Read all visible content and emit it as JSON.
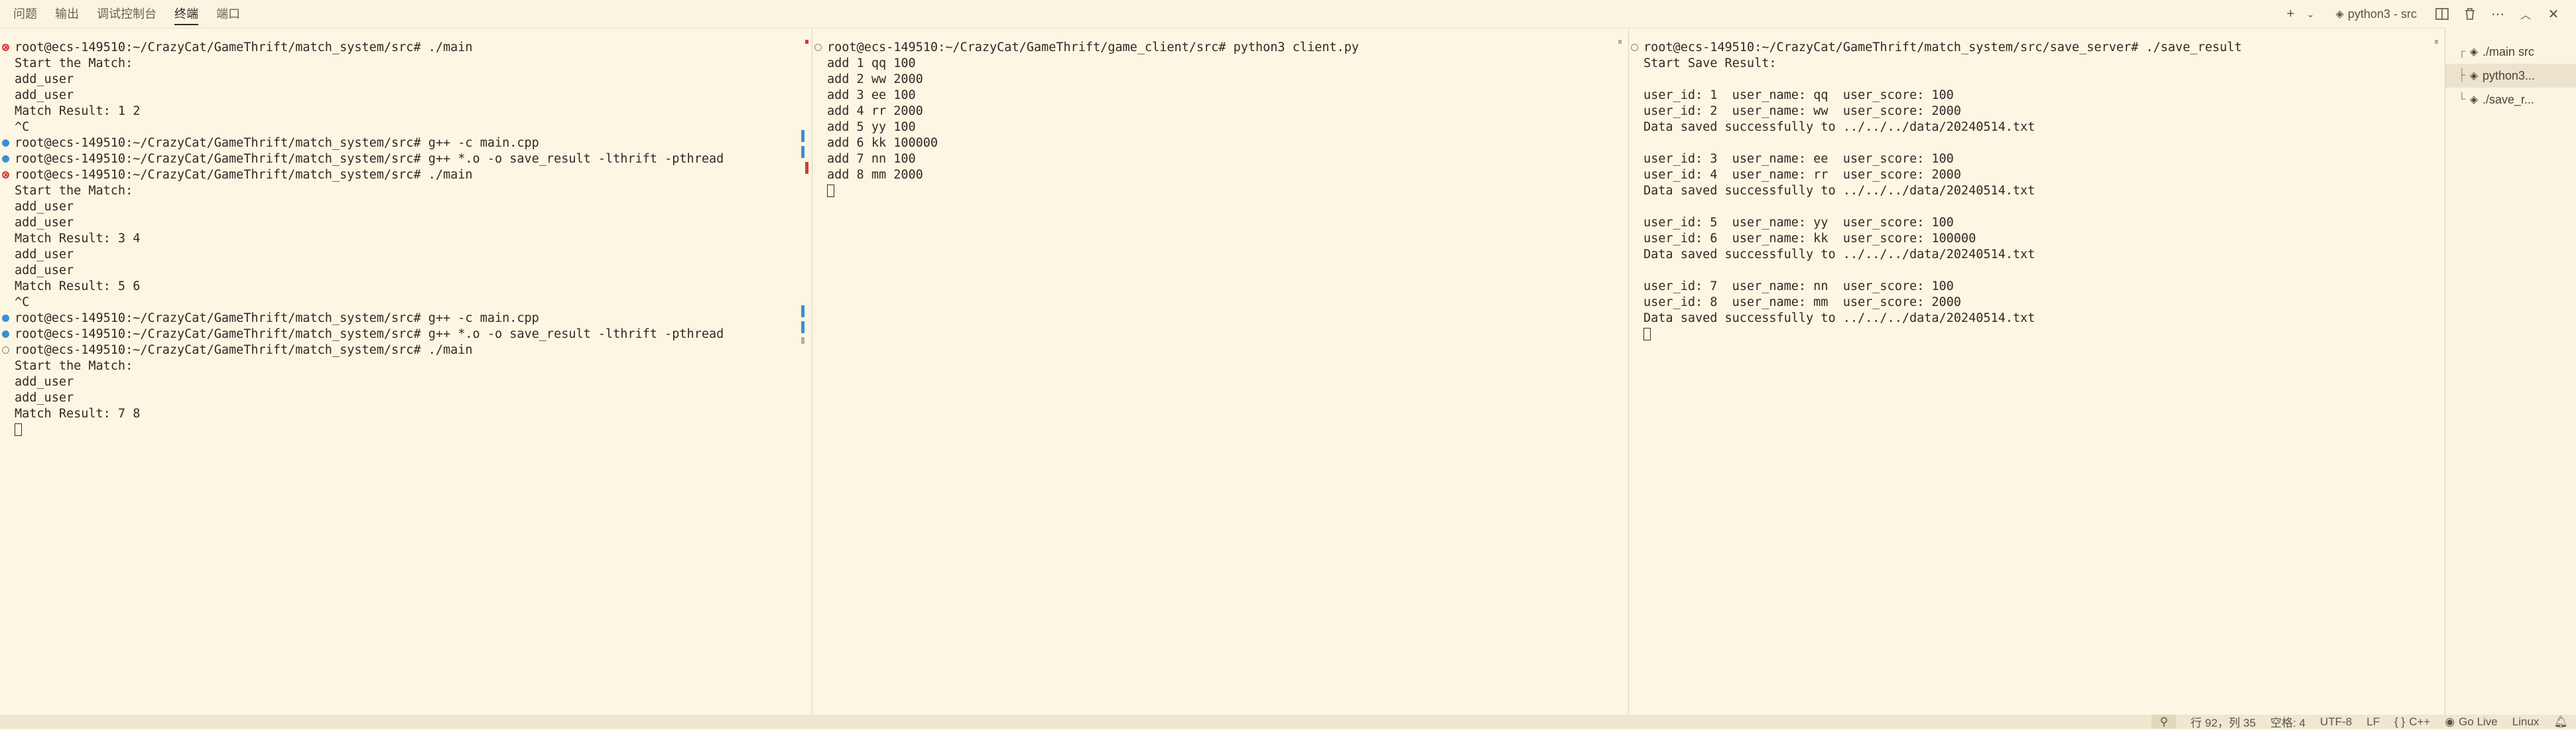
{
  "panel_tabs": [
    "问题",
    "输出",
    "调试控制台",
    "终端",
    "端口"
  ],
  "active_tab_index": 3,
  "toolbar": {
    "add_icon": "plus-icon",
    "terminal_label": "python3 - src"
  },
  "pane1": {
    "lines": [
      {
        "deco": "err",
        "text": "root@ecs-149510:~/CrazyCat/GameThrift/match_system/src# ./main"
      },
      {
        "deco": "",
        "text": "Start the Match:"
      },
      {
        "deco": "",
        "text": "add_user"
      },
      {
        "deco": "",
        "text": "add_user"
      },
      {
        "deco": "",
        "text": "Match Result: 1 2"
      },
      {
        "deco": "",
        "text": "^C"
      },
      {
        "deco": "ok",
        "text": "root@ecs-149510:~/CrazyCat/GameThrift/match_system/src# g++ -c main.cpp"
      },
      {
        "deco": "ok",
        "text": "root@ecs-149510:~/CrazyCat/GameThrift/match_system/src# g++ *.o -o save_result -lthrift -pthread"
      },
      {
        "deco": "err",
        "text": "root@ecs-149510:~/CrazyCat/GameThrift/match_system/src# ./main"
      },
      {
        "deco": "",
        "text": "Start the Match:"
      },
      {
        "deco": "",
        "text": "add_user"
      },
      {
        "deco": "",
        "text": "add_user"
      },
      {
        "deco": "",
        "text": "Match Result: 3 4"
      },
      {
        "deco": "",
        "text": "add_user"
      },
      {
        "deco": "",
        "text": "add_user"
      },
      {
        "deco": "",
        "text": "Match Result: 5 6"
      },
      {
        "deco": "",
        "text": "^C"
      },
      {
        "deco": "ok",
        "text": "root@ecs-149510:~/CrazyCat/GameThrift/match_system/src# g++ -c main.cpp"
      },
      {
        "deco": "ok",
        "text": "root@ecs-149510:~/CrazyCat/GameThrift/match_system/src# g++ *.o -o save_result -lthrift -pthread"
      },
      {
        "deco": "hollow",
        "text": "root@ecs-149510:~/CrazyCat/GameThrift/match_system/src# ./main"
      },
      {
        "deco": "",
        "text": "Start the Match:"
      },
      {
        "deco": "",
        "text": "add_user"
      },
      {
        "deco": "",
        "text": "add_user"
      },
      {
        "deco": "",
        "text": "Match Result: 7 8"
      }
    ]
  },
  "pane2": {
    "lines": [
      {
        "deco": "hollow",
        "text": "root@ecs-149510:~/CrazyCat/GameThrift/game_client/src# python3 client.py"
      },
      {
        "deco": "",
        "text": "add 1 qq 100"
      },
      {
        "deco": "",
        "text": "add 2 ww 2000"
      },
      {
        "deco": "",
        "text": "add 3 ee 100"
      },
      {
        "deco": "",
        "text": "add 4 rr 2000"
      },
      {
        "deco": "",
        "text": "add 5 yy 100"
      },
      {
        "deco": "",
        "text": "add 6 kk 100000"
      },
      {
        "deco": "",
        "text": "add 7 nn 100"
      },
      {
        "deco": "",
        "text": "add 8 mm 2000"
      }
    ]
  },
  "pane3": {
    "lines": [
      {
        "deco": "hollow",
        "text": "root@ecs-149510:~/CrazyCat/GameThrift/match_system/src/save_server# ./save_result"
      },
      {
        "deco": "",
        "text": "Start Save Result:"
      },
      {
        "deco": "",
        "text": ""
      },
      {
        "deco": "",
        "text": "user_id: 1  user_name: qq  user_score: 100"
      },
      {
        "deco": "",
        "text": "user_id: 2  user_name: ww  user_score: 2000"
      },
      {
        "deco": "",
        "text": "Data saved successfully to ../../../data/20240514.txt"
      },
      {
        "deco": "",
        "text": ""
      },
      {
        "deco": "",
        "text": "user_id: 3  user_name: ee  user_score: 100"
      },
      {
        "deco": "",
        "text": "user_id: 4  user_name: rr  user_score: 2000"
      },
      {
        "deco": "",
        "text": "Data saved successfully to ../../../data/20240514.txt"
      },
      {
        "deco": "",
        "text": ""
      },
      {
        "deco": "",
        "text": "user_id: 5  user_name: yy  user_score: 100"
      },
      {
        "deco": "",
        "text": "user_id: 6  user_name: kk  user_score: 100000"
      },
      {
        "deco": "",
        "text": "Data saved successfully to ../../../data/20240514.txt"
      },
      {
        "deco": "",
        "text": ""
      },
      {
        "deco": "",
        "text": "user_id: 7  user_name: nn  user_score: 100"
      },
      {
        "deco": "",
        "text": "user_id: 8  user_name: mm  user_score: 2000"
      },
      {
        "deco": "",
        "text": "Data saved successfully to ../../../data/20240514.txt"
      }
    ]
  },
  "terminal_list": [
    {
      "label": "./main  src",
      "selected": false,
      "tree": "┌"
    },
    {
      "label": "python3...",
      "selected": true,
      "tree": "├"
    },
    {
      "label": "./save_r...",
      "selected": false,
      "tree": "└"
    }
  ],
  "statusbar": {
    "position": "行 92，列 35",
    "indent": "空格: 4",
    "encoding": "UTF-8",
    "eol": "LF",
    "language": "C++",
    "golive": "Go Live",
    "os": "Linux"
  },
  "colors": {
    "background": "#fdf6e3",
    "error_decoration": "#d03d3d",
    "success_decoration": "#3a8fd4"
  }
}
